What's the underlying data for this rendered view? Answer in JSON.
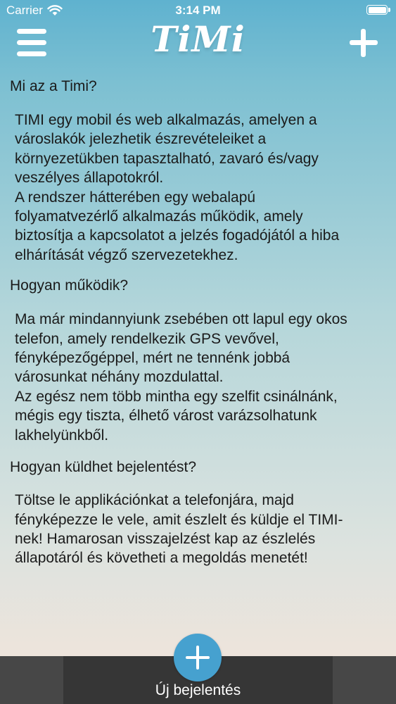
{
  "status_bar": {
    "carrier": "Carrier",
    "time": "3:14 PM",
    "icons": [
      "wifi-icon",
      "battery-icon"
    ]
  },
  "nav": {
    "logo": "TiMi",
    "menu_icon": "hamburger-menu-icon",
    "add_icon": "plus-icon"
  },
  "sections": [
    {
      "title": "Mi az a Timi?",
      "body": "TIMI egy mobil és web alkalmazás, amelyen a\nvároslakók jelezhetik észrevételeiket a\nkörnyezetükben tapasztalható, zavaró és/vagy\nveszélyes állapotokról.\nA rendszer hátterében egy webalapú\nfolyamatvezérlő alkalmazás működik, amely\nbiztosítja a kapcsolatot a jelzés fogadójától a hiba\nelhárítását végző szervezetekhez."
    },
    {
      "title": "Hogyan működik?",
      "body": "Ma már mindannyiunk zsebében ott lapul egy okos\ntelefon, amely rendelkezik GPS vevővel,\nfényképezőgéppel, mért ne tennénk jobbá\nvárosunkat néhány mozdulattal.\nAz egész nem több mintha egy szelfit csinálnánk,\nmégis egy tiszta, élhető várost varázsolhatunk\nlakhelyünkből."
    },
    {
      "title": "Hogyan küldhet bejelentést?",
      "body": "Töltse le applikációnkat a telefonjára, majd\nfényképezze le vele, amit észlelt és küldje el TIMI-\nnek! Hamarosan visszajelzést kap az észlelés\nállapotáról és követheti a megoldás menetét!"
    }
  ],
  "bottom": {
    "new_report_label": "Új bejelentés",
    "fab_icon": "plus-icon"
  },
  "colors": {
    "gradient_top": "#5fb2cf",
    "gradient_bottom": "#f5e4da",
    "bottom_bar": "#474747",
    "bottom_tab": "#363636",
    "fab": "#46a1cf"
  }
}
